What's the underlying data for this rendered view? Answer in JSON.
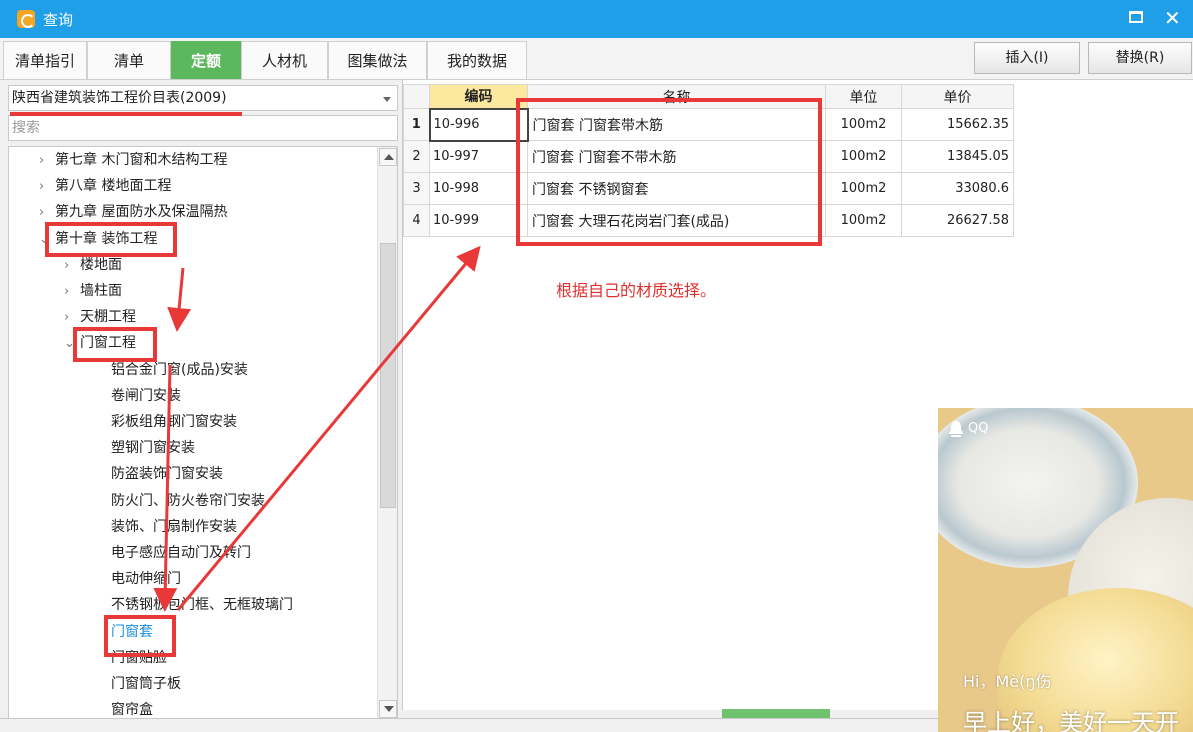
{
  "window": {
    "title": "查询"
  },
  "tabs": [
    {
      "label": "清单指引"
    },
    {
      "label": "清单"
    },
    {
      "label": "定额",
      "active": true
    },
    {
      "label": "人材机"
    },
    {
      "label": "图集做法"
    },
    {
      "label": "我的数据"
    }
  ],
  "toolbar": {
    "insert_label": "插入(I)",
    "replace_label": "替换(R)"
  },
  "library": {
    "selected": "陕西省建筑装饰工程价目表(2009)"
  },
  "search": {
    "placeholder": "搜索",
    "value": ""
  },
  "tree": {
    "items": [
      {
        "label": "第七章 木门窗和木结构工程",
        "level": 0,
        "caret": ">"
      },
      {
        "label": "第八章 楼地面工程",
        "level": 0,
        "caret": ">"
      },
      {
        "label": "第九章 屋面防水及保温隔热",
        "level": 0,
        "caret": ">"
      },
      {
        "label": "第十章 装饰工程",
        "level": 0,
        "caret": "v"
      },
      {
        "label": "楼地面",
        "level": 1,
        "caret": ">"
      },
      {
        "label": "墙柱面",
        "level": 1,
        "caret": ">"
      },
      {
        "label": "天棚工程",
        "level": 1,
        "caret": ">"
      },
      {
        "label": "门窗工程",
        "level": 1,
        "caret": "v"
      },
      {
        "label": "铝合金门窗(成品)安装",
        "level": 2
      },
      {
        "label": "卷闸门安装",
        "level": 2
      },
      {
        "label": "彩板组角钢门窗安装",
        "level": 2
      },
      {
        "label": "塑钢门窗安装",
        "level": 2
      },
      {
        "label": "防盗装饰门窗安装",
        "level": 2
      },
      {
        "label": "防火门、防火卷帘门安装",
        "level": 2
      },
      {
        "label": "装饰、门扇制作安装",
        "level": 2
      },
      {
        "label": "电子感应自动门及转门",
        "level": 2
      },
      {
        "label": "电动伸缩门",
        "level": 2
      },
      {
        "label": "不锈钢板包门框、无框玻璃门",
        "level": 2
      },
      {
        "label": "门窗套",
        "level": 2,
        "selected": true
      },
      {
        "label": "门窗贴脸",
        "level": 2
      },
      {
        "label": "门窗筒子板",
        "level": 2
      },
      {
        "label": "窗帘盒",
        "level": 2
      }
    ]
  },
  "table": {
    "headers": {
      "code": "编码",
      "name": "名称",
      "unit": "单位",
      "price": "单价"
    },
    "rows": [
      {
        "index": "1",
        "code": "10-996",
        "name": "门窗套 门窗套带木筋",
        "unit": "100m2",
        "price": "15662.35"
      },
      {
        "index": "2",
        "code": "10-997",
        "name": "门窗套 门窗套不带木筋",
        "unit": "100m2",
        "price": "13845.05"
      },
      {
        "index": "3",
        "code": "10-998",
        "name": "门窗套 不锈钢窗套",
        "unit": "100m2",
        "price": "33080.6"
      },
      {
        "index": "4",
        "code": "10-999",
        "name": "门窗套 大理石花岗岩门套(成品)",
        "unit": "100m2",
        "price": "26627.58"
      }
    ]
  },
  "annotation": {
    "hint": "根据自己的材质选择。"
  },
  "qq_popup": {
    "app": "QQ",
    "greeting": "Hi，Mè(ŋ伤",
    "message": "早上好，美好一天开"
  },
  "colors": {
    "titlebar": "#1e9fe7",
    "active_tab": "#5cb85c",
    "annotation_red": "#e83838",
    "selected_item": "#1a8ee0"
  }
}
